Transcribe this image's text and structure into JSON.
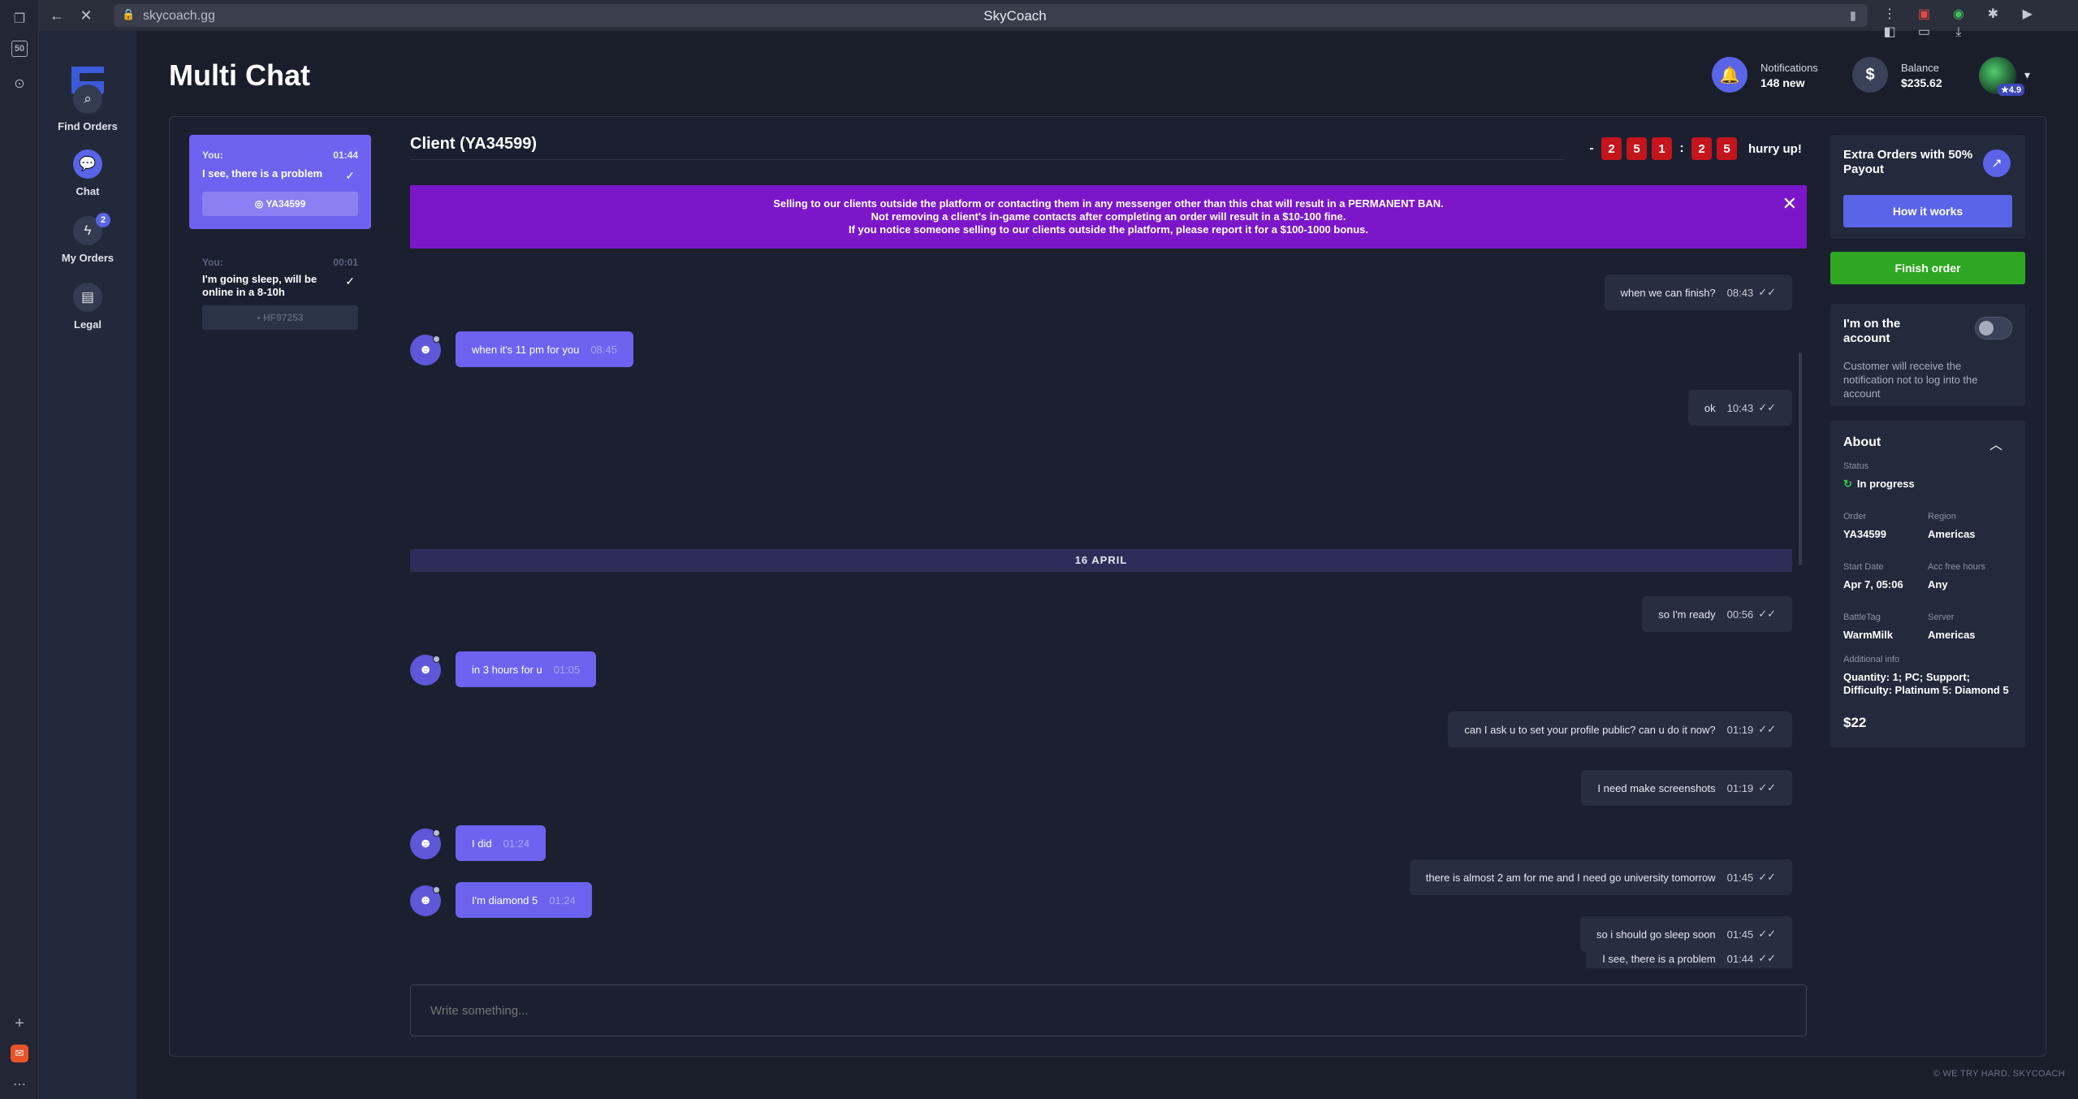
{
  "browser": {
    "url": "skycoach.gg",
    "page_title": "SkyCoach",
    "left_badge": "50"
  },
  "sidebar": {
    "items": [
      {
        "label": "Find Orders",
        "icon": "search-icon"
      },
      {
        "label": "Chat",
        "icon": "chat-icon"
      },
      {
        "label": "My Orders",
        "icon": "lightning-icon",
        "badge": "2"
      },
      {
        "label": "Legal",
        "icon": "document-icon"
      }
    ]
  },
  "header": {
    "title": "Multi Chat",
    "notifications": {
      "label": "Notifications",
      "value": "148 new"
    },
    "balance": {
      "label": "Balance",
      "value": "$235.62"
    },
    "rating": "★4.9"
  },
  "conversations": [
    {
      "you": "You:",
      "time": "01:44",
      "message": "I see, there is a problem",
      "chip": "YA34599"
    },
    {
      "you": "You:",
      "time": "00:01",
      "message": "I'm going sleep, will be online in a 8-10h",
      "chip": "HF97253"
    }
  ],
  "chat": {
    "title": "Client (YA34599)",
    "timer": {
      "prefix": "-",
      "digits_a": [
        "2",
        "5",
        "1"
      ],
      "separator": ":",
      "digits_b": [
        "2",
        "5"
      ],
      "label": "hurry up!"
    },
    "warning": [
      "Selling to our clients outside the platform or contacting them in any messenger other than this chat will result in a PERMANENT BAN.",
      "Not removing a client's in-game contacts after completing an order will result in a $10-100 fine.",
      "If you notice someone selling to our clients outside the platform, please report it for a $100-1000 bonus."
    ],
    "date_separator": "16 APRIL",
    "messages": [
      {
        "side": "own",
        "text": "when we can finish?",
        "time": "08:43"
      },
      {
        "side": "in",
        "text": "when it's 11 pm for you",
        "time": "08:45"
      },
      {
        "side": "own",
        "text": "ok",
        "time": "10:43"
      },
      {
        "side": "own",
        "text": "so I'm ready",
        "time": "00:56"
      },
      {
        "side": "in",
        "text": "in 3 hours for u",
        "time": "01:05"
      },
      {
        "side": "own",
        "text": "can I ask u to set your profile public? can u do it now?",
        "time": "01:19"
      },
      {
        "side": "own",
        "text": "I need make screenshots",
        "time": "01:19"
      },
      {
        "side": "in",
        "text": "I did",
        "time": "01:24"
      },
      {
        "side": "in",
        "text": "I'm diamond 5",
        "time": "01:24"
      },
      {
        "side": "own",
        "text": "I see, there is a problem",
        "time": "01:44"
      },
      {
        "side": "own",
        "text": "there is almost 2 am for me and I need go university tomorrow",
        "time": "01:45"
      },
      {
        "side": "own",
        "text": "so i should go sleep soon",
        "time": "01:45"
      }
    ],
    "composer_placeholder": "Write something..."
  },
  "right": {
    "extra_title": "Extra Orders with 50% Payout",
    "how_it_works": "How it works",
    "finish_order": "Finish order",
    "account_title": "I'm on the account",
    "account_desc": "Customer will receive the notification not to log into the account",
    "about": {
      "title": "About",
      "status_label": "Status",
      "status_value": "In progress",
      "order_label": "Order",
      "order_value": "YA34599",
      "region_label": "Region",
      "region_value": "Americas",
      "start_label": "Start Date",
      "start_value": "Apr 7, 05:06",
      "acc_label": "Acc free hours",
      "acc_value": "Any",
      "battletag_label": "BattleTag",
      "battletag_value": "WarmMilk",
      "server_label": "Server",
      "server_value": "Americas",
      "additional_label": "Additional info",
      "additional_value": "Quantity: 1; PC; Support; Difficulty: Platinum 5: Diamond 5",
      "price": "$22"
    }
  },
  "footer": {
    "copyright": "© WE TRY HARD. SKYCOACH"
  }
}
